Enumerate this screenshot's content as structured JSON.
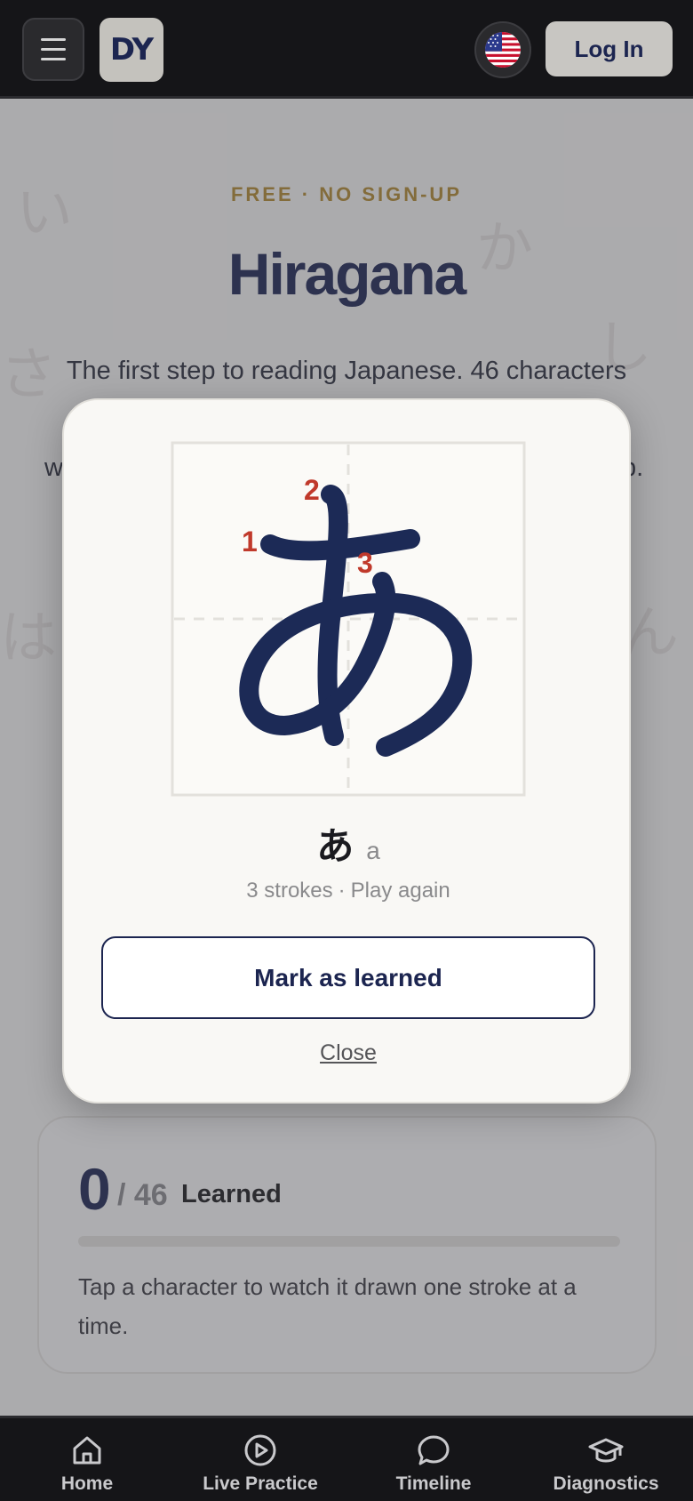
{
  "header": {
    "logo_text": "DY",
    "login_label": "Log In"
  },
  "hero": {
    "eyebrow": "FREE · NO SIGN-UP",
    "title": "Hiragana",
    "intro": "The first step to reading Japanese. 46 characters",
    "intro_tail_left": "w",
    "intro_tail_right": "p.",
    "background_chars": [
      "い",
      "か",
      "さ",
      "し",
      "は",
      "ん"
    ]
  },
  "progress": {
    "count": "0",
    "total": "/ 46",
    "label": "Learned",
    "fraction_learned": 0,
    "hint": "Tap a character to watch it drawn one stroke at a time."
  },
  "modal": {
    "stroke_numbers": [
      "1",
      "2",
      "3"
    ],
    "kana": "あ",
    "romaji": "a",
    "stroke_count_text": "3 strokes",
    "separator": "·",
    "play_again": "Play again",
    "mark_learned_label": "Mark as learned",
    "close_label": "Close"
  },
  "bottom_nav": {
    "items": [
      {
        "label": "Home",
        "icon": "home-icon"
      },
      {
        "label": "Live Practice",
        "icon": "play-circle-icon"
      },
      {
        "label": "Timeline",
        "icon": "chat-bubble-icon"
      },
      {
        "label": "Diagnostics",
        "icon": "graduation-cap-icon"
      }
    ]
  },
  "colors": {
    "navy": "#1c2550",
    "accent_gold": "#b0892e",
    "stroke_number_red": "#c0392b",
    "bar_dark": "#151518"
  }
}
